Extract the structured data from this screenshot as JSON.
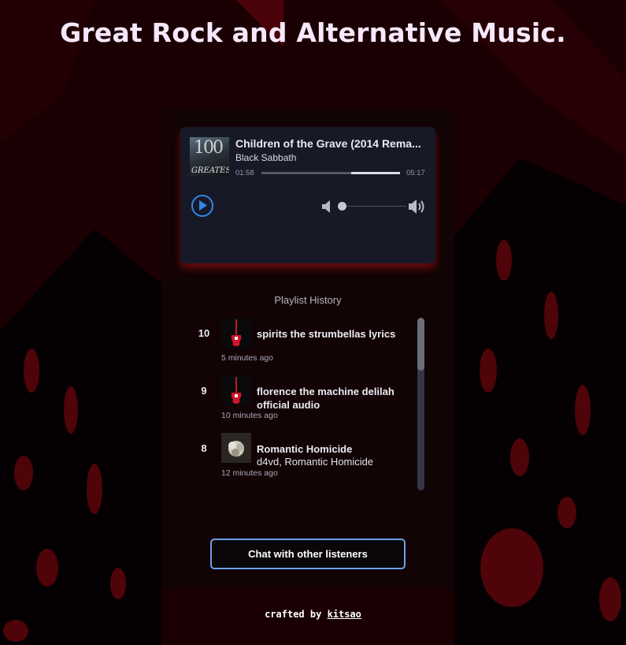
{
  "header": {
    "title": "Great Rock and Alternative Music."
  },
  "player": {
    "track_title": "Children of the Grave (2014 Rema...",
    "artist": "Black Sabbath",
    "current_time": "01:58",
    "duration": "05:17",
    "progress_fraction": 0.37,
    "volume_fraction": 0.0,
    "album_art_text": {
      "number": "100",
      "word": "GREATEST"
    },
    "accent_color": "#2f86e6",
    "icons": {
      "play": "play-icon",
      "mute": "volume-mute-icon",
      "max": "volume-max-icon"
    }
  },
  "history": {
    "title": "Playlist History",
    "items": [
      {
        "rank": "10",
        "title": "spirits the strumbellas lyrics",
        "artist": "",
        "time": "5 minutes ago",
        "thumb": "red-guitar"
      },
      {
        "rank": "9",
        "title": "florence the machine delilah official audio",
        "artist": "",
        "time": "10 minutes ago",
        "thumb": "red-guitar"
      },
      {
        "rank": "8",
        "title": "Romantic Homicide",
        "artist": "d4vd, Romantic Homicide",
        "time": "12 minutes ago",
        "thumb": "flower"
      }
    ]
  },
  "chat": {
    "button_label": "Chat with other listeners"
  },
  "footer": {
    "prefix": "crafted by ",
    "author": "kitsao"
  }
}
